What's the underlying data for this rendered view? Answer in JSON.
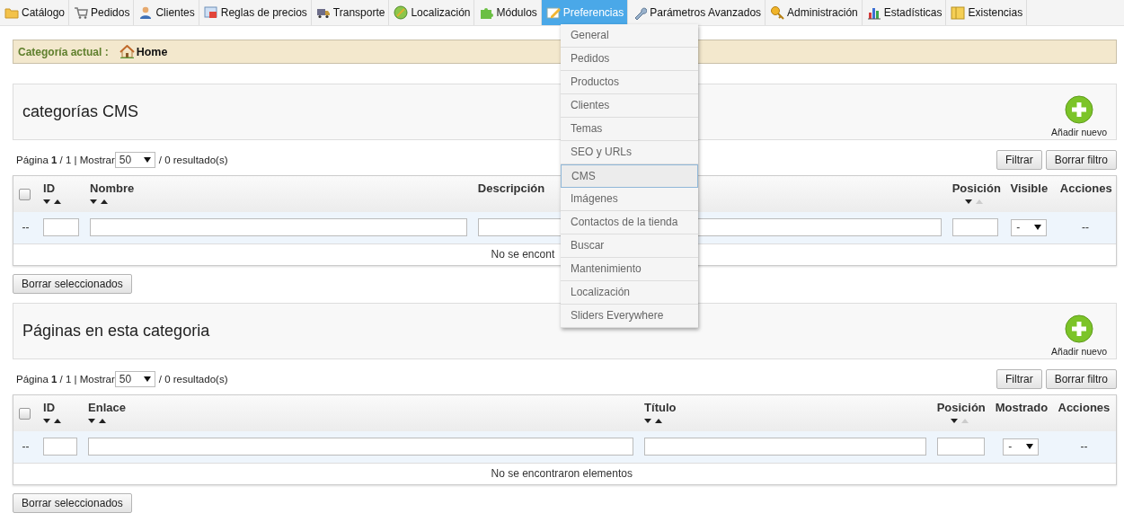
{
  "nav": [
    {
      "label": "Catálogo",
      "selected": false
    },
    {
      "label": "Pedidos",
      "selected": false
    },
    {
      "label": "Clientes",
      "selected": false
    },
    {
      "label": "Reglas de precios",
      "selected": false
    },
    {
      "label": "Transporte",
      "selected": false
    },
    {
      "label": "Localización",
      "selected": false
    },
    {
      "label": "Módulos",
      "selected": false
    },
    {
      "label": "Preferencias",
      "selected": true
    },
    {
      "label": "Parámetros Avanzados",
      "selected": false
    },
    {
      "label": "Administración",
      "selected": false
    },
    {
      "label": "Estadísticas",
      "selected": false
    },
    {
      "label": "Existencias",
      "selected": false
    }
  ],
  "menu": [
    {
      "label": "General",
      "selected": false
    },
    {
      "label": "Pedidos",
      "selected": false
    },
    {
      "label": "Productos",
      "selected": false
    },
    {
      "label": "Clientes",
      "selected": false
    },
    {
      "label": "Temas",
      "selected": false
    },
    {
      "label": "SEO y URLs",
      "selected": false
    },
    {
      "label": "CMS",
      "selected": true
    },
    {
      "label": "Imágenes",
      "selected": false
    },
    {
      "label": "Contactos de la tienda",
      "selected": false
    },
    {
      "label": "Buscar",
      "selected": false
    },
    {
      "label": "Mantenimiento",
      "selected": false
    },
    {
      "label": "Localización",
      "selected": false
    },
    {
      "label": "Sliders Everywhere",
      "selected": false
    }
  ],
  "breadcrumb": {
    "label": "Categoría actual :",
    "current": "Home"
  },
  "sections": [
    {
      "title": "categorías CMS",
      "add_button": "Añadir nuevo",
      "pagination": {
        "prefix": "Página",
        "page": "1",
        "suffix": "/ 1 | Mostrar",
        "per_page": "50",
        "results": "/ 0 resultado(s)"
      },
      "filter_buttons": [
        "Filtrar",
        "Borrar filtro"
      ],
      "table": {
        "select_all_checked": false,
        "columns": [
          {
            "label": "ID",
            "sortable": true,
            "sort_up_disabled": false
          },
          {
            "label": "Nombre",
            "sortable": true,
            "sort_up_disabled": false
          },
          {
            "label": "Descripción",
            "sortable": false
          },
          {
            "label": "Posición",
            "sortable": true,
            "sort_up_disabled": true
          },
          {
            "label": "Visible",
            "sortable": false
          },
          {
            "label": "Acciones",
            "sortable": false
          }
        ],
        "filters": [
          {
            "kind": "text",
            "text": "--"
          },
          {
            "kind": "input"
          },
          {
            "kind": "input"
          },
          {
            "kind": "input"
          },
          {
            "kind": "input"
          },
          {
            "kind": "select",
            "value": "-"
          },
          {
            "kind": "text",
            "text": "--"
          }
        ],
        "empty_message": "No se encont"
      },
      "bulk_button": "Borrar seleccionados"
    },
    {
      "title": "Páginas en esta categoria",
      "add_button": "Añadir nuevo",
      "pagination": {
        "prefix": "Página",
        "page": "1",
        "suffix": "/ 1 | Mostrar",
        "per_page": "50",
        "results": "/ 0 resultado(s)"
      },
      "filter_buttons": [
        "Filtrar",
        "Borrar filtro"
      ],
      "table": {
        "select_all_checked": false,
        "columns": [
          {
            "label": "ID",
            "sortable": true,
            "sort_up_disabled": false
          },
          {
            "label": "Enlace",
            "sortable": true,
            "sort_up_disabled": false
          },
          {
            "label": "Título",
            "sortable": true,
            "sort_up_disabled": false
          },
          {
            "label": "Posición",
            "sortable": true,
            "sort_up_disabled": true
          },
          {
            "label": "Mostrado",
            "sortable": false
          },
          {
            "label": "Acciones",
            "sortable": false
          }
        ],
        "filters": [
          {
            "kind": "text",
            "text": "--"
          },
          {
            "kind": "input"
          },
          {
            "kind": "input"
          },
          {
            "kind": "input"
          },
          {
            "kind": "input"
          },
          {
            "kind": "select",
            "value": "-"
          },
          {
            "kind": "text",
            "text": "--"
          }
        ],
        "empty_message": "No se encontraron elementos"
      },
      "bulk_button": "Borrar seleccionados"
    }
  ]
}
